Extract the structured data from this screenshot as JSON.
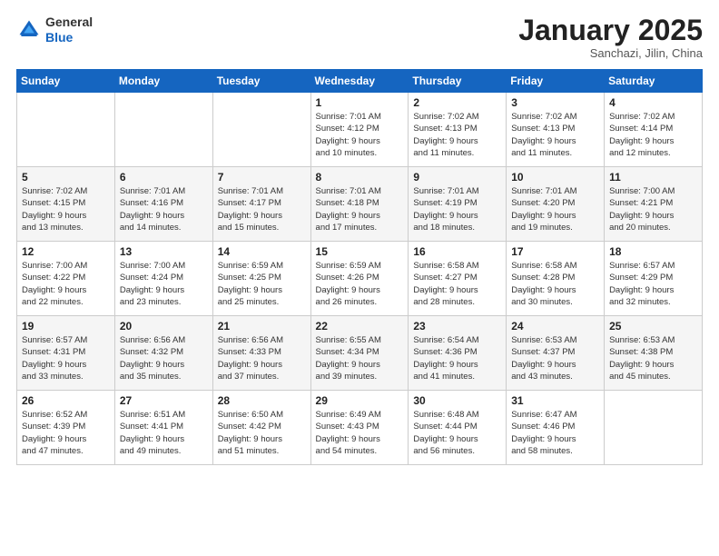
{
  "header": {
    "logo_line1": "General",
    "logo_line2": "Blue",
    "month": "January 2025",
    "location": "Sanchazi, Jilin, China"
  },
  "weekdays": [
    "Sunday",
    "Monday",
    "Tuesday",
    "Wednesday",
    "Thursday",
    "Friday",
    "Saturday"
  ],
  "rows": [
    [
      {
        "day": "",
        "info": ""
      },
      {
        "day": "",
        "info": ""
      },
      {
        "day": "",
        "info": ""
      },
      {
        "day": "1",
        "info": "Sunrise: 7:01 AM\nSunset: 4:12 PM\nDaylight: 9 hours\nand 10 minutes."
      },
      {
        "day": "2",
        "info": "Sunrise: 7:02 AM\nSunset: 4:13 PM\nDaylight: 9 hours\nand 11 minutes."
      },
      {
        "day": "3",
        "info": "Sunrise: 7:02 AM\nSunset: 4:13 PM\nDaylight: 9 hours\nand 11 minutes."
      },
      {
        "day": "4",
        "info": "Sunrise: 7:02 AM\nSunset: 4:14 PM\nDaylight: 9 hours\nand 12 minutes."
      }
    ],
    [
      {
        "day": "5",
        "info": "Sunrise: 7:02 AM\nSunset: 4:15 PM\nDaylight: 9 hours\nand 13 minutes."
      },
      {
        "day": "6",
        "info": "Sunrise: 7:01 AM\nSunset: 4:16 PM\nDaylight: 9 hours\nand 14 minutes."
      },
      {
        "day": "7",
        "info": "Sunrise: 7:01 AM\nSunset: 4:17 PM\nDaylight: 9 hours\nand 15 minutes."
      },
      {
        "day": "8",
        "info": "Sunrise: 7:01 AM\nSunset: 4:18 PM\nDaylight: 9 hours\nand 17 minutes."
      },
      {
        "day": "9",
        "info": "Sunrise: 7:01 AM\nSunset: 4:19 PM\nDaylight: 9 hours\nand 18 minutes."
      },
      {
        "day": "10",
        "info": "Sunrise: 7:01 AM\nSunset: 4:20 PM\nDaylight: 9 hours\nand 19 minutes."
      },
      {
        "day": "11",
        "info": "Sunrise: 7:00 AM\nSunset: 4:21 PM\nDaylight: 9 hours\nand 20 minutes."
      }
    ],
    [
      {
        "day": "12",
        "info": "Sunrise: 7:00 AM\nSunset: 4:22 PM\nDaylight: 9 hours\nand 22 minutes."
      },
      {
        "day": "13",
        "info": "Sunrise: 7:00 AM\nSunset: 4:24 PM\nDaylight: 9 hours\nand 23 minutes."
      },
      {
        "day": "14",
        "info": "Sunrise: 6:59 AM\nSunset: 4:25 PM\nDaylight: 9 hours\nand 25 minutes."
      },
      {
        "day": "15",
        "info": "Sunrise: 6:59 AM\nSunset: 4:26 PM\nDaylight: 9 hours\nand 26 minutes."
      },
      {
        "day": "16",
        "info": "Sunrise: 6:58 AM\nSunset: 4:27 PM\nDaylight: 9 hours\nand 28 minutes."
      },
      {
        "day": "17",
        "info": "Sunrise: 6:58 AM\nSunset: 4:28 PM\nDaylight: 9 hours\nand 30 minutes."
      },
      {
        "day": "18",
        "info": "Sunrise: 6:57 AM\nSunset: 4:29 PM\nDaylight: 9 hours\nand 32 minutes."
      }
    ],
    [
      {
        "day": "19",
        "info": "Sunrise: 6:57 AM\nSunset: 4:31 PM\nDaylight: 9 hours\nand 33 minutes."
      },
      {
        "day": "20",
        "info": "Sunrise: 6:56 AM\nSunset: 4:32 PM\nDaylight: 9 hours\nand 35 minutes."
      },
      {
        "day": "21",
        "info": "Sunrise: 6:56 AM\nSunset: 4:33 PM\nDaylight: 9 hours\nand 37 minutes."
      },
      {
        "day": "22",
        "info": "Sunrise: 6:55 AM\nSunset: 4:34 PM\nDaylight: 9 hours\nand 39 minutes."
      },
      {
        "day": "23",
        "info": "Sunrise: 6:54 AM\nSunset: 4:36 PM\nDaylight: 9 hours\nand 41 minutes."
      },
      {
        "day": "24",
        "info": "Sunrise: 6:53 AM\nSunset: 4:37 PM\nDaylight: 9 hours\nand 43 minutes."
      },
      {
        "day": "25",
        "info": "Sunrise: 6:53 AM\nSunset: 4:38 PM\nDaylight: 9 hours\nand 45 minutes."
      }
    ],
    [
      {
        "day": "26",
        "info": "Sunrise: 6:52 AM\nSunset: 4:39 PM\nDaylight: 9 hours\nand 47 minutes."
      },
      {
        "day": "27",
        "info": "Sunrise: 6:51 AM\nSunset: 4:41 PM\nDaylight: 9 hours\nand 49 minutes."
      },
      {
        "day": "28",
        "info": "Sunrise: 6:50 AM\nSunset: 4:42 PM\nDaylight: 9 hours\nand 51 minutes."
      },
      {
        "day": "29",
        "info": "Sunrise: 6:49 AM\nSunset: 4:43 PM\nDaylight: 9 hours\nand 54 minutes."
      },
      {
        "day": "30",
        "info": "Sunrise: 6:48 AM\nSunset: 4:44 PM\nDaylight: 9 hours\nand 56 minutes."
      },
      {
        "day": "31",
        "info": "Sunrise: 6:47 AM\nSunset: 4:46 PM\nDaylight: 9 hours\nand 58 minutes."
      },
      {
        "day": "",
        "info": ""
      }
    ]
  ]
}
